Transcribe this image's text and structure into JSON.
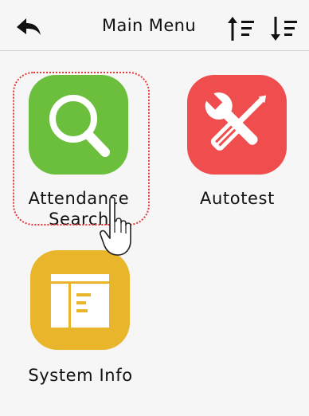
{
  "header": {
    "title": "Main Menu",
    "back_icon": "back-arrow-icon",
    "sort_ascending_icon": "sort-ascending-icon",
    "sort_descending_icon": "sort-descending-icon"
  },
  "menu": {
    "items": [
      {
        "label": "Attendance Search",
        "icon": "magnifier-icon",
        "color": "#6bbf3d",
        "selected": true
      },
      {
        "label": "Autotest",
        "icon": "wrench-screwdriver-icon",
        "color": "#f04e4e",
        "selected": false
      },
      {
        "label": "System Info",
        "icon": "system-info-icon",
        "color": "#e9b52a",
        "selected": false
      }
    ]
  },
  "colors": {
    "background": "#f6f6f6",
    "selection_ring": "#e03a3a"
  }
}
